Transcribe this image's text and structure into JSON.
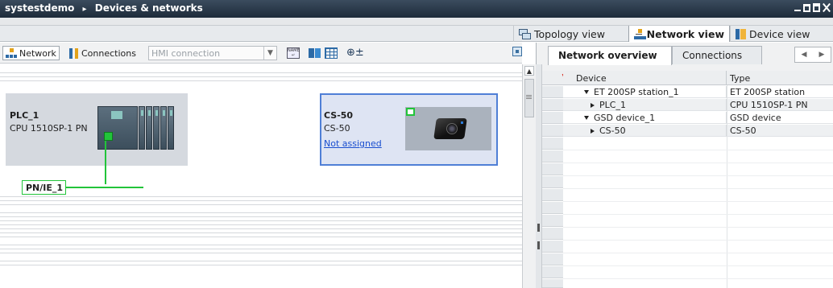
{
  "window": {
    "project": "systestdemo",
    "breadcrumb_sep": "▸",
    "section": "Devices & networks"
  },
  "views": {
    "topology": "Topology view",
    "network": "Network view",
    "device": "Device view",
    "active": "Network view"
  },
  "toolbar": {
    "network_label": "Network",
    "connections_label": "Connections",
    "hmi_select_value": "HMI connection",
    "zoom_label": "⊕±"
  },
  "canvas": {
    "plc": {
      "name": "PLC_1",
      "type": "CPU 1510SP-1 PN"
    },
    "subnet": {
      "label": "PN/IE_1",
      "color": "#22c43a"
    },
    "cs50": {
      "name": "CS-50",
      "type": "CS-50",
      "link": "Not assigned"
    }
  },
  "overview": {
    "tabs": {
      "overview": "Network overview",
      "connections": "Connections"
    },
    "columns": {
      "device": "Device",
      "type": "Type"
    },
    "rows": [
      {
        "device": "ET 200SP station_1",
        "type": "ET 200SP station",
        "expander": "down"
      },
      {
        "device": "PLC_1",
        "type": "CPU 1510SP-1 PN",
        "expander": "right"
      },
      {
        "device": "GSD device_1",
        "type": "GSD device",
        "expander": "down"
      },
      {
        "device": "CS-50",
        "type": "CS-50",
        "expander": "right"
      }
    ]
  },
  "colors": {
    "titlebar": "#2a3a4c",
    "selection_border": "#4f7fd6",
    "link": "#1a4fd0",
    "port_green": "#22c43a"
  }
}
